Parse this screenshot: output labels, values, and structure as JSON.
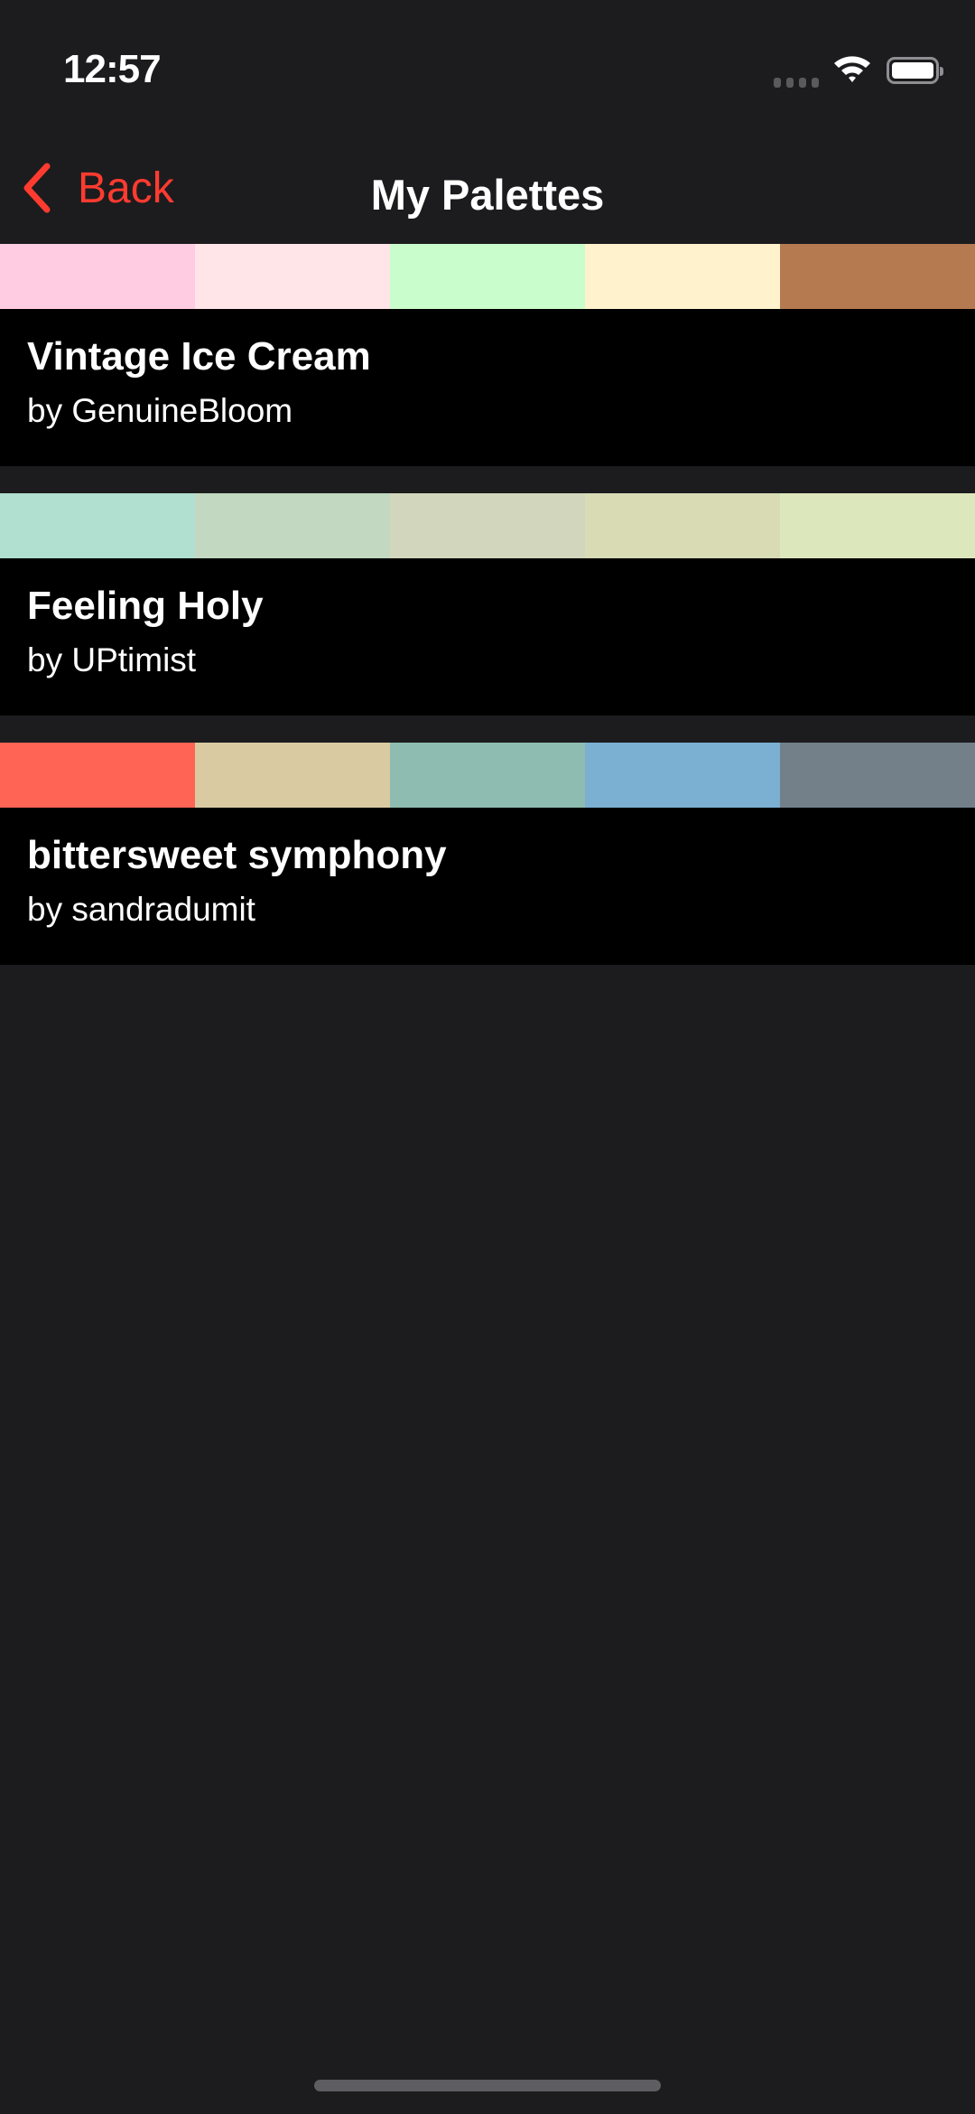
{
  "status_bar": {
    "time": "12:57"
  },
  "nav": {
    "back_label": "Back",
    "title": "My Palettes",
    "accent": "#ff3b30"
  },
  "palettes": [
    {
      "name": "Vintage Ice Cream",
      "author": "by GenuineBloom",
      "colors": [
        "#FFCCE1",
        "#FFE4E8",
        "#C9FDCB",
        "#FFF2CC",
        "#B67A50"
      ]
    },
    {
      "name": "Feeling Holy",
      "author": "by UPtimist",
      "colors": [
        "#B2E0D0",
        "#C2D8C0",
        "#D2D6BC",
        "#D8DBB4",
        "#DCE7BC"
      ]
    },
    {
      "name": "bittersweet symphony",
      "author": "by sandradumit",
      "colors": [
        "#FF6454",
        "#D9CAA2",
        "#8FBCB0",
        "#7BB0D2",
        "#738089"
      ]
    }
  ]
}
